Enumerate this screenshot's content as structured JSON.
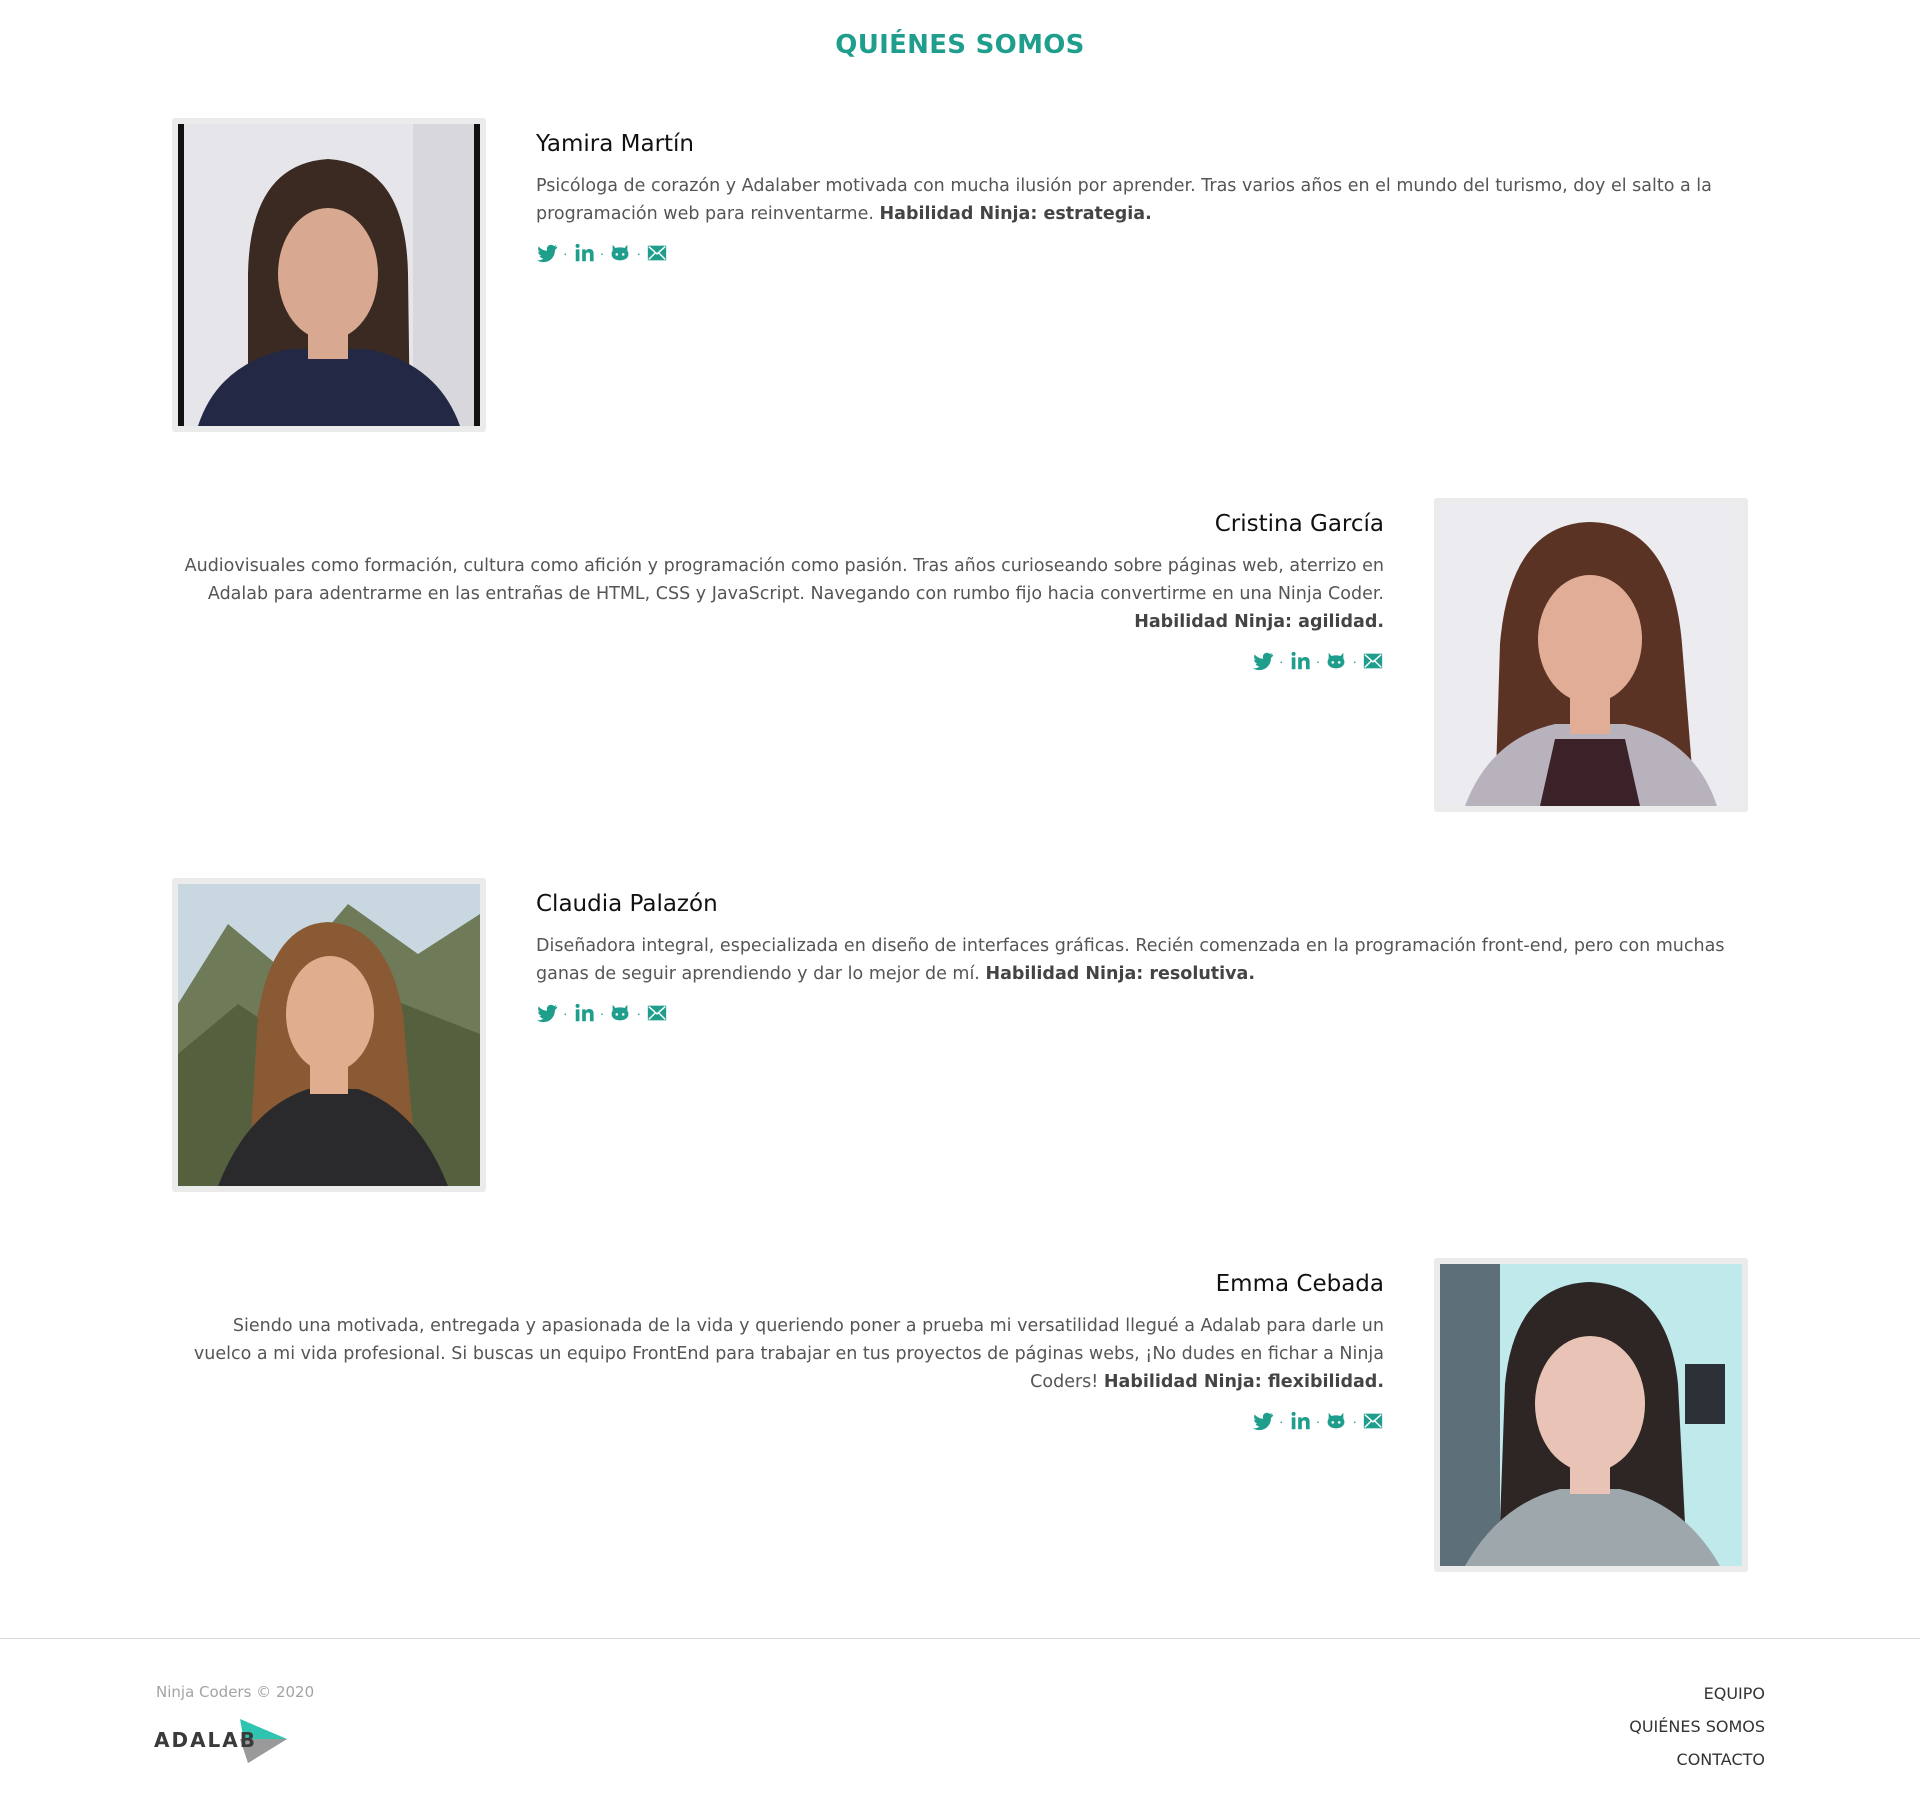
{
  "page": {
    "title": "QUIÉNES SOMOS"
  },
  "colors": {
    "accent": "#1f9e8d",
    "text": "#555555",
    "heading": "#111111",
    "frame": "#ebebeb"
  },
  "members": [
    {
      "name": "Yamira Martín",
      "bio": "Psicóloga de corazón y Adalaber motivada con mucha ilusión por aprender. Tras varios años en el mundo del turismo, doy el salto a la programación web para reinventarme.",
      "skill": "Habilidad Ninja: estrategia.",
      "photo_alt": "Yamira Martín"
    },
    {
      "name": "Cristina García",
      "bio": "Audiovisuales como formación, cultura como afición y programación como pasión. Tras años curioseando sobre páginas web, aterrizo en Adalab para adentrarme en las entrañas de HTML, CSS y JavaScript. Navegando con rumbo fijo hacia convertirme en una Ninja Coder.",
      "skill": "Habilidad Ninja: agilidad.",
      "photo_alt": "Cristina García"
    },
    {
      "name": "Claudia Palazón",
      "bio": "Diseñadora integral, especializada en diseño de interfaces gráficas. Recién comenzada en la programación front-end, pero con muchas ganas de seguir aprendiendo y dar lo mejor de mí.",
      "skill": "Habilidad Ninja: resolutiva.",
      "photo_alt": "Claudia Palazón"
    },
    {
      "name": "Emma Cebada",
      "bio": "Siendo una motivada, entregada y apasionada de la vida y queriendo poner a prueba mi versatilidad llegué a Adalab para darle un vuelco a mi vida profesional. Si buscas un equipo FrontEnd para trabajar en tus proyectos de páginas webs, ¡No dudes en fichar a Ninja Coders!",
      "skill": "Habilidad Ninja: flexibilidad.",
      "photo_alt": "Emma Cebada"
    }
  ],
  "social_icons": [
    "twitter-icon",
    "linkedin-icon",
    "github-icon",
    "mail-icon"
  ],
  "social_separator": "·",
  "footer": {
    "copyright": "Ninja Coders © 2020",
    "logo_text": "ADALAB",
    "nav": [
      "EQUIPO",
      "QUIÉNES SOMOS",
      "CONTACTO"
    ]
  }
}
